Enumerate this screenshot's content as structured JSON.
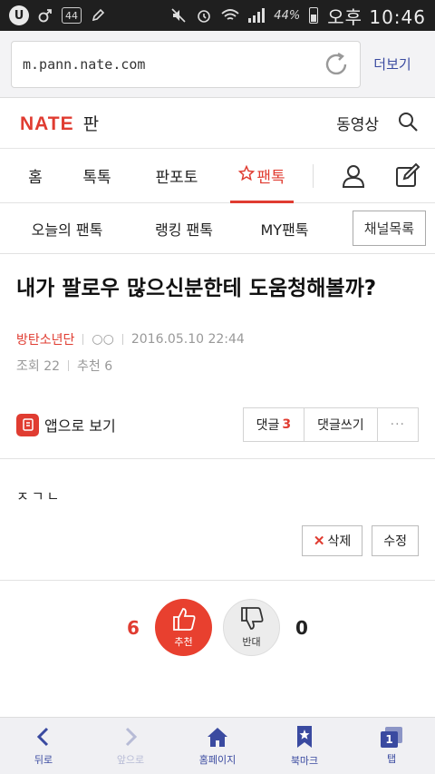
{
  "status_bar": {
    "left": {
      "notice_badge": "U",
      "data_usage": "44"
    },
    "right": {
      "battery_pct": "44%",
      "time": "오후 10:46"
    }
  },
  "browser": {
    "url": "m.pann.nate.com",
    "more_label": "더보기"
  },
  "header": {
    "logo_nate": "NATE",
    "logo_pan": "판",
    "video_label": "동영상"
  },
  "main_nav": {
    "tabs": [
      {
        "label": "홈"
      },
      {
        "label": "톡톡"
      },
      {
        "label": "판포토"
      },
      {
        "label": "팬톡",
        "active": true
      }
    ]
  },
  "sub_nav": {
    "tabs": [
      {
        "label": "오늘의 팬톡"
      },
      {
        "label": "랭킹 팬톡"
      },
      {
        "label": "MY팬톡"
      }
    ],
    "channel_button": "채널목록"
  },
  "article": {
    "title": "내가 팔로우 많으신분한테 도움청해볼까?",
    "author": "방탄소년단",
    "author_mark": "○○",
    "date": "2016.05.10 22:44",
    "views": "조회 22",
    "recommends": "추천 6",
    "content": "ㅈㄱㄴ"
  },
  "actions": {
    "app_view": "앱으로 보기",
    "comment_label": "댓글",
    "comment_count": "3",
    "write_comment": "댓글쓰기",
    "more": "···",
    "delete": "삭제",
    "edit": "수정"
  },
  "votes": {
    "up_count": "6",
    "up_label": "추천",
    "down_count": "0",
    "down_label": "반대"
  },
  "bottom_bar": {
    "back": "뒤로",
    "forward": "앞으로",
    "home": "홈페이지",
    "bookmark": "북마크",
    "tabs": "탭",
    "tab_count": "1"
  },
  "colors": {
    "accent": "#e03c31",
    "browser_blue": "#3a4aa0"
  }
}
